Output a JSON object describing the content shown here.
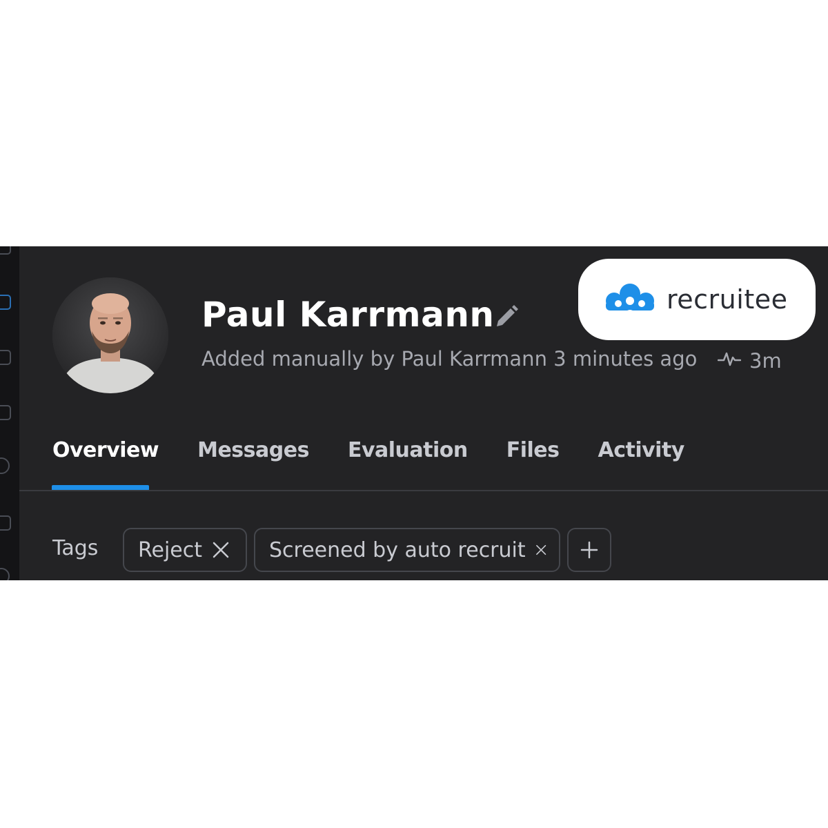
{
  "candidate": {
    "name": "Paul Karrmann",
    "added_info": "Added manually by Paul Karrmann 3 minutes ago",
    "activity_time": "3m"
  },
  "logo": {
    "text": "recruitee"
  },
  "tabs": [
    {
      "label": "Overview",
      "active": true
    },
    {
      "label": "Messages",
      "active": false
    },
    {
      "label": "Evaluation",
      "active": false
    },
    {
      "label": "Files",
      "active": false
    },
    {
      "label": "Activity",
      "active": false
    }
  ],
  "tags": {
    "label": "Tags",
    "items": [
      "Reject",
      "Screened by auto recruit"
    ]
  },
  "icons": {
    "edit": "pencil-icon",
    "activity": "pulse-icon",
    "remove": "close-icon",
    "add": "plus-icon"
  },
  "colors": {
    "background": "#232325",
    "accent": "#1e8fe8",
    "logo_blue": "#1e8fe8"
  }
}
